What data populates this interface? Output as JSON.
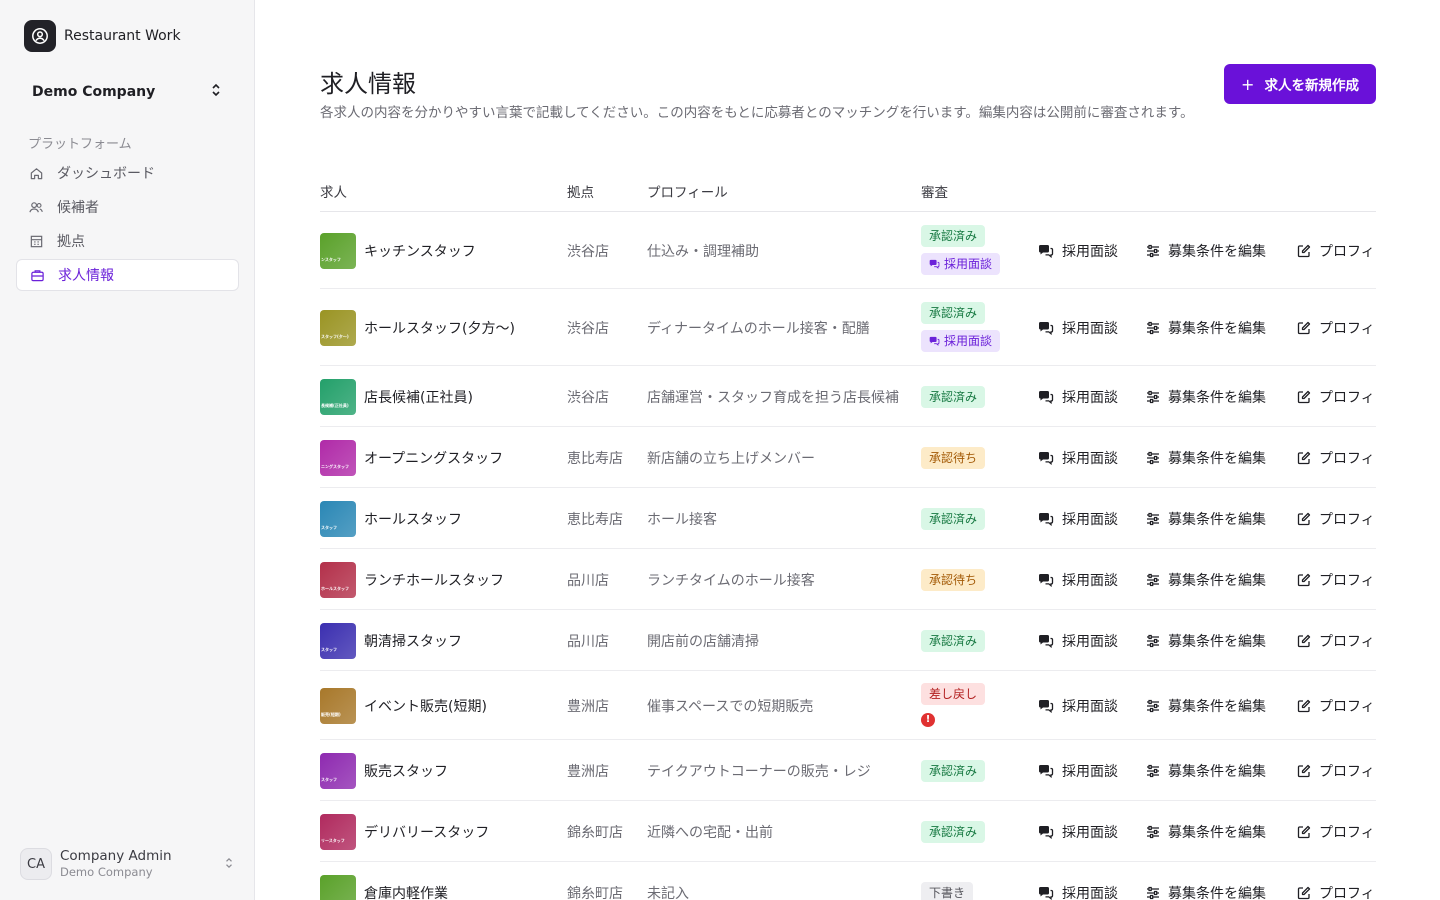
{
  "app": {
    "name": "Restaurant Work"
  },
  "company_switcher": {
    "name": "Demo Company"
  },
  "sidebar": {
    "section_label": "プラットフォーム",
    "items": [
      {
        "label": "ダッシュボード",
        "icon": "home-icon"
      },
      {
        "label": "候補者",
        "icon": "users-icon"
      },
      {
        "label": "拠点",
        "icon": "building-icon"
      },
      {
        "label": "求人情報",
        "icon": "briefcase-icon",
        "active": true
      }
    ]
  },
  "user": {
    "initials": "CA",
    "name": "Company Admin",
    "company": "Demo Company"
  },
  "page": {
    "title": "求人情報",
    "description": "各求人の内容を分かりやすい言葉で記載してください。この内容をもとに応募者とのマッチングを行います。編集内容は公開前に審査されます。",
    "create_button": "求人を新規作成"
  },
  "table": {
    "headers": {
      "job": "求人",
      "location": "拠点",
      "profile": "プロフィール",
      "review": "審査"
    },
    "actions": {
      "interview": "採用面談",
      "edit_conditions": "募集条件を編集",
      "profile": "プロフィ"
    },
    "badge_labels": {
      "approved": "承認済み",
      "pending": "承認待ち",
      "returned": "差し戻し",
      "draft": "下書き",
      "interview": "採用面談"
    },
    "rows": [
      {
        "title": "キッチンスタッフ",
        "location": "渋谷店",
        "profile": "仕込み・調理補助",
        "status": "approved",
        "interview_badge": true,
        "thumb_text": "ンスタッフ",
        "thumb_color": "#5aa12a"
      },
      {
        "title": "ホールスタッフ(夕方〜)",
        "location": "渋谷店",
        "profile": "ディナータイムのホール接客・配膳",
        "status": "approved",
        "interview_badge": true,
        "thumb_text": "スタッフ(夕〜)",
        "thumb_color": "#9a9423"
      },
      {
        "title": "店長候補(正社員)",
        "location": "渋谷店",
        "profile": "店舗運営・スタッフ育成を担う店長候補",
        "status": "approved",
        "interview_badge": false,
        "thumb_text": "長候補(正社員)",
        "thumb_color": "#23a06a"
      },
      {
        "title": "オープニングスタッフ",
        "location": "恵比寿店",
        "profile": "新店舗の立ち上げメンバー",
        "status": "pending",
        "interview_badge": false,
        "thumb_text": "ニングスタッフ",
        "thumb_color": "#b02aa8"
      },
      {
        "title": "ホールスタッフ",
        "location": "恵比寿店",
        "profile": "ホール接客",
        "status": "approved",
        "interview_badge": false,
        "thumb_text": "スタッフ",
        "thumb_color": "#2a87b5"
      },
      {
        "title": "ランチホールスタッフ",
        "location": "品川店",
        "profile": "ランチタイムのホール接客",
        "status": "pending",
        "interview_badge": false,
        "thumb_text": "ホールスタッフ",
        "thumb_color": "#b3304a"
      },
      {
        "title": "朝清掃スタッフ",
        "location": "品川店",
        "profile": "開店前の店舗清掃",
        "status": "approved",
        "interview_badge": false,
        "thumb_text": "スタッフ",
        "thumb_color": "#3b2fb0"
      },
      {
        "title": "イベント販売(短期)",
        "location": "豊洲店",
        "profile": "催事スペースでの短期販売",
        "status": "returned",
        "interview_badge": false,
        "thumb_text": "販売(短期)",
        "thumb_color": "#a8782a"
      },
      {
        "title": "販売スタッフ",
        "location": "豊洲店",
        "profile": "テイクアウトコーナーの販売・レジ",
        "status": "approved",
        "interview_badge": false,
        "thumb_text": "スタッフ",
        "thumb_color": "#8e2ab0"
      },
      {
        "title": "デリバリースタッフ",
        "location": "錦糸町店",
        "profile": "近隣への宅配・出前",
        "status": "approved",
        "interview_badge": false,
        "thumb_text": "リースタッフ",
        "thumb_color": "#b02a5e"
      },
      {
        "title": "倉庫内軽作業",
        "location": "錦糸町店",
        "profile": "未記入",
        "status": "draft",
        "interview_badge": false,
        "thumb_text": "",
        "thumb_color": "#5aa12a"
      }
    ]
  },
  "colors": {
    "accent": "#6a11d9",
    "sidebar_bg": "#f6f6f7"
  }
}
